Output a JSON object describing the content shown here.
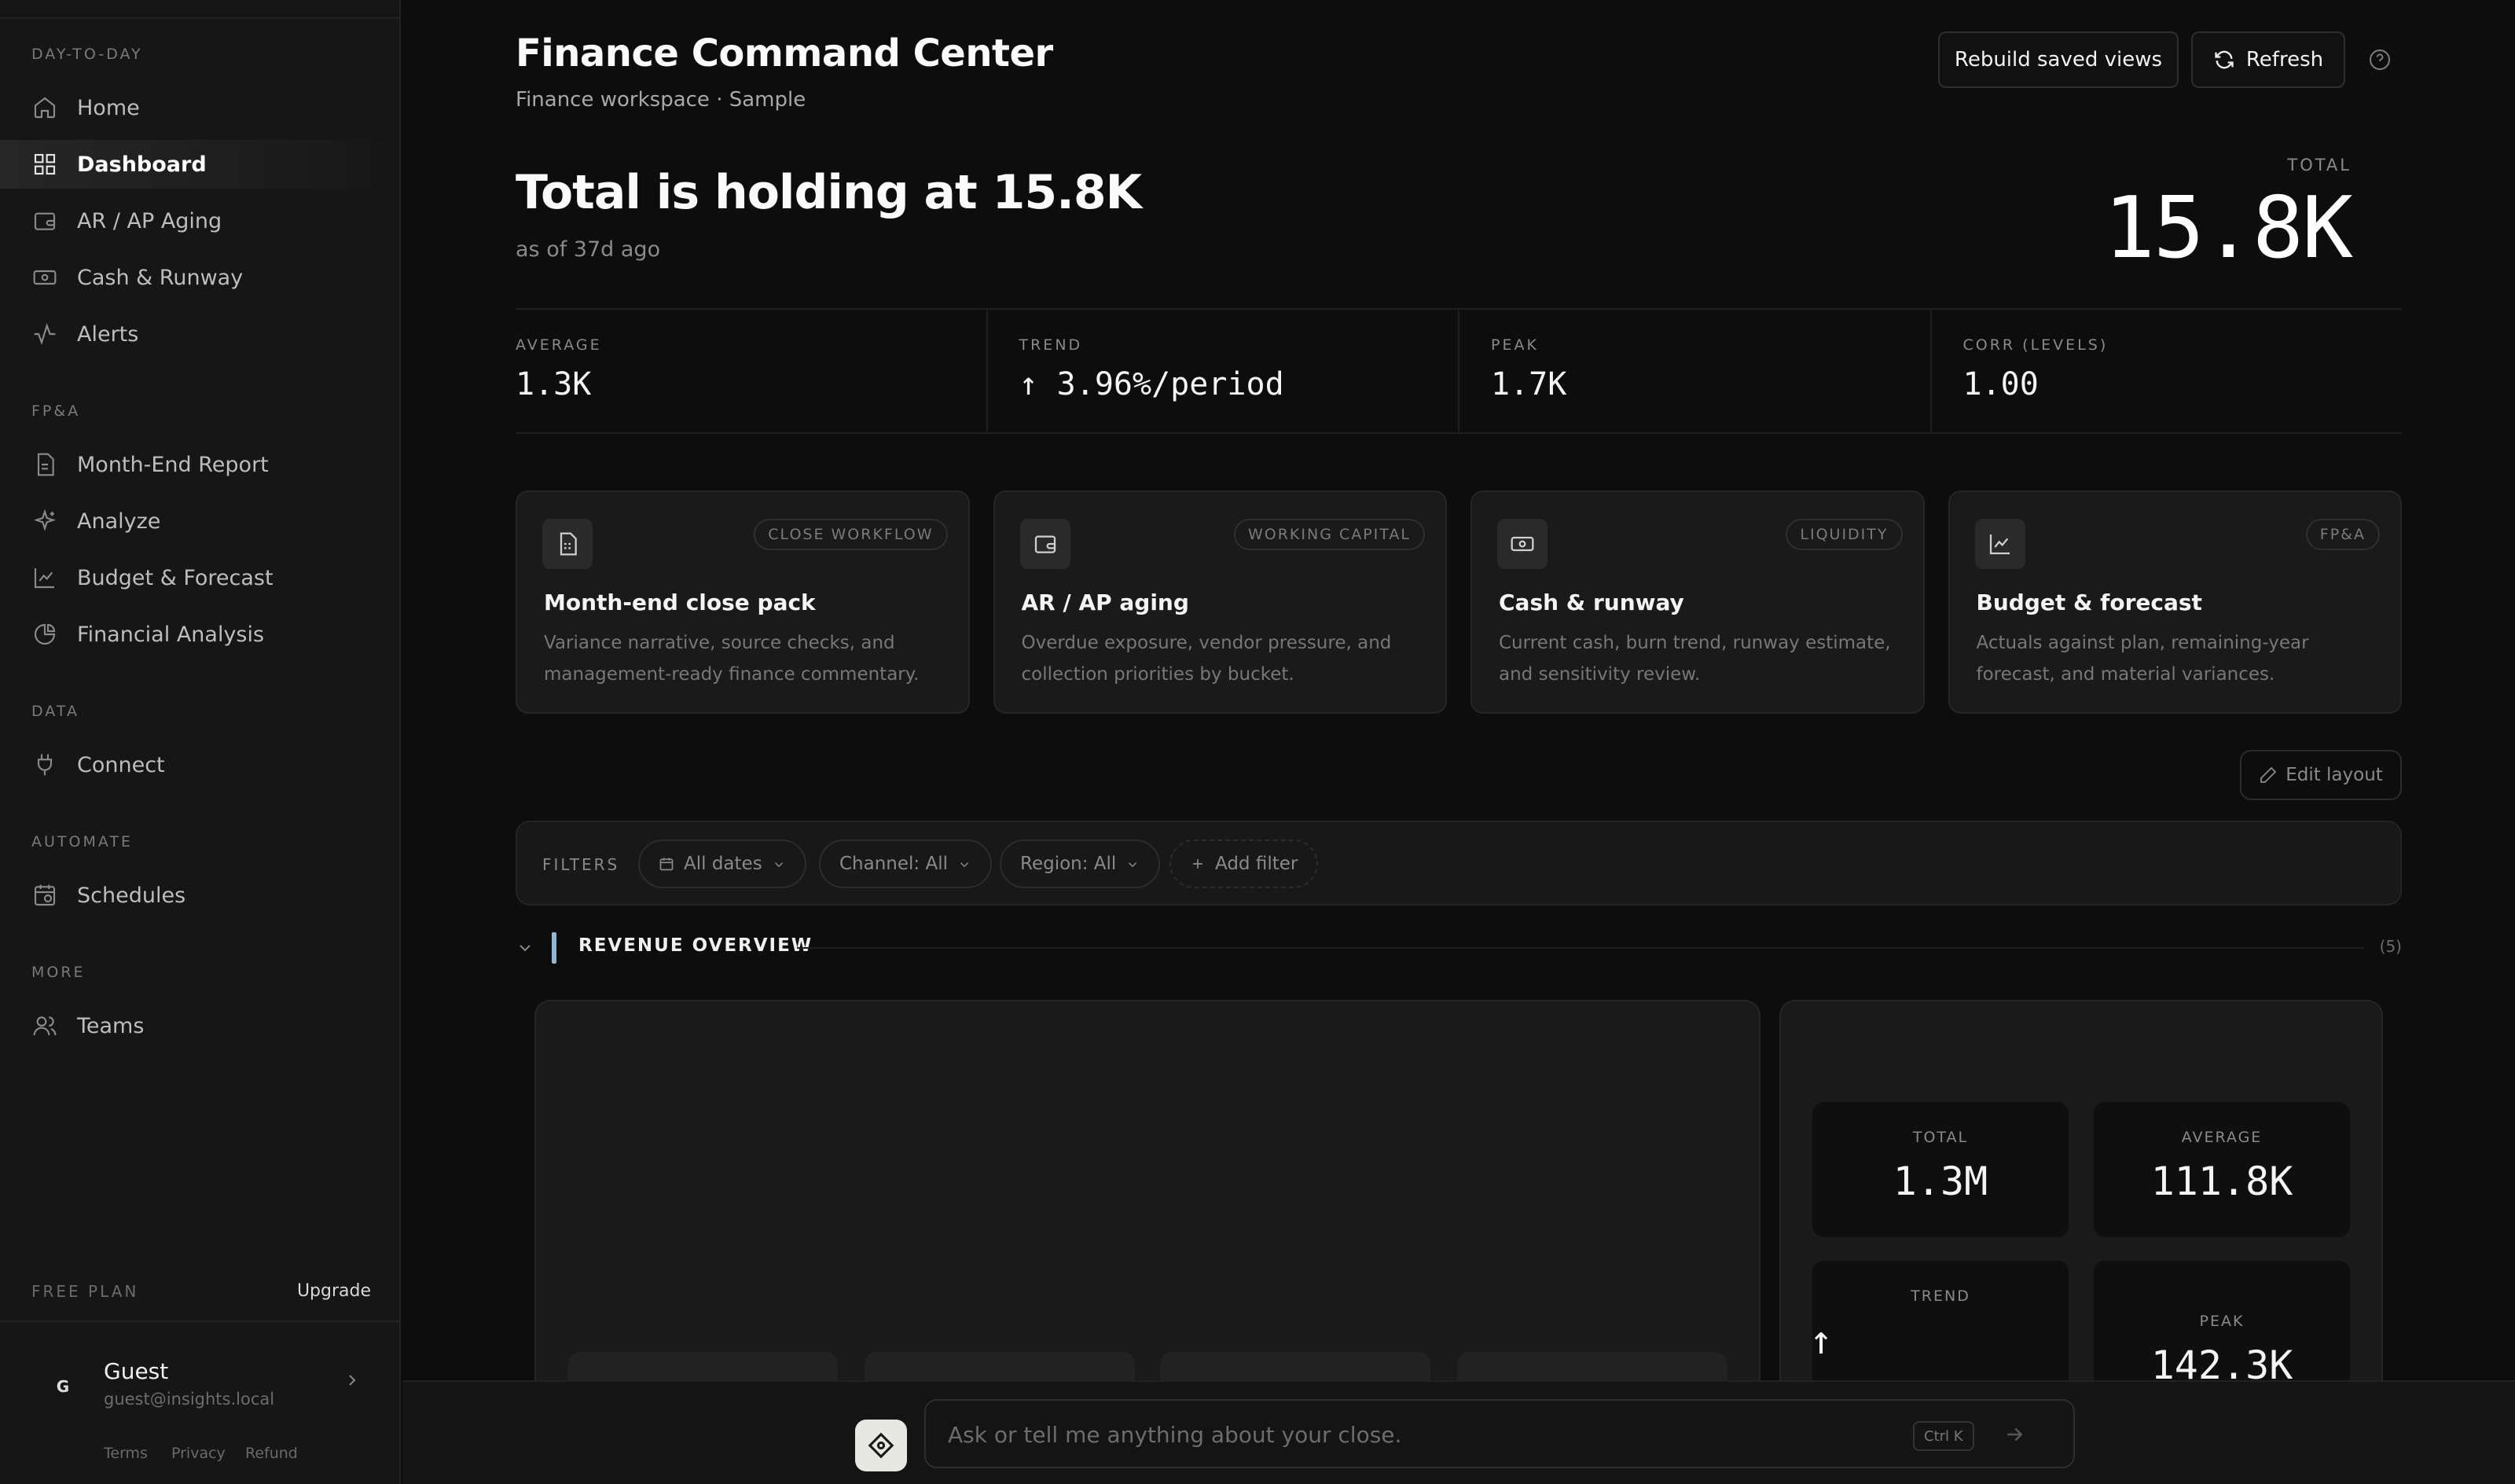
{
  "sidebar": {
    "sections": [
      {
        "label": "DAY-TO-DAY"
      },
      {
        "label": "FP&A"
      },
      {
        "label": "DATA"
      },
      {
        "label": "AUTOMATE"
      },
      {
        "label": "MORE"
      }
    ],
    "items": [
      {
        "label": "Home",
        "icon": "home-icon"
      },
      {
        "label": "Dashboard",
        "icon": "grid-icon",
        "active": true
      },
      {
        "label": "AR / AP Aging",
        "icon": "wallet-icon"
      },
      {
        "label": "Cash & Runway",
        "icon": "banknote-icon"
      },
      {
        "label": "Alerts",
        "icon": "activity-icon"
      },
      {
        "label": "Month-End Report",
        "icon": "file-text-icon"
      },
      {
        "label": "Analyze",
        "icon": "sparkles-icon"
      },
      {
        "label": "Budget & Forecast",
        "icon": "line-chart-icon"
      },
      {
        "label": "Financial Analysis",
        "icon": "pie-chart-icon"
      },
      {
        "label": "Connect",
        "icon": "plug-icon"
      },
      {
        "label": "Schedules",
        "icon": "calendar-clock-icon"
      },
      {
        "label": "Teams",
        "icon": "users-icon"
      }
    ],
    "plan": {
      "label": "FREE PLAN",
      "upgrade": "Upgrade"
    },
    "user": {
      "initial": "G",
      "name": "Guest",
      "email": "guest@insights.local"
    },
    "legal": {
      "terms": "Terms",
      "privacy": "Privacy",
      "refund": "Refund"
    }
  },
  "header": {
    "title": "Finance Command Center",
    "subtitle": "Finance workspace · Sample",
    "rebuild_label": "Rebuild saved views",
    "refresh_label": "Refresh"
  },
  "summary": {
    "headline": "Total is holding at 15.8K",
    "as_of": "as of 37d ago",
    "kpi_label": "TOTAL",
    "kpi_value": "15.8K"
  },
  "stats": [
    {
      "label": "AVERAGE",
      "value": "1.3K"
    },
    {
      "label": "TREND",
      "value": "↑ 3.96%/period"
    },
    {
      "label": "PEAK",
      "value": "1.7K"
    },
    {
      "label": "CORR (LEVELS)",
      "value": "1.00"
    }
  ],
  "cards": [
    {
      "tag": "CLOSE WORKFLOW",
      "title": "Month-end close pack",
      "desc": "Variance narrative, source checks, and management-ready finance commentary.",
      "icon": "file-text-icon"
    },
    {
      "tag": "WORKING CAPITAL",
      "title": "AR / AP aging",
      "desc": "Overdue exposure, vendor pressure, and collection priorities by bucket.",
      "icon": "wallet-icon"
    },
    {
      "tag": "LIQUIDITY",
      "title": "Cash & runway",
      "desc": "Current cash, burn trend, runway estimate, and sensitivity review.",
      "icon": "banknote-icon"
    },
    {
      "tag": "FP&A",
      "title": "Budget & forecast",
      "desc": "Actuals against plan, remaining-year forecast, and material variances.",
      "icon": "line-chart-icon"
    }
  ],
  "edit_layout": "Edit layout",
  "filters": {
    "label": "FILTERS",
    "chips": [
      "All dates",
      "Channel: All",
      "Region: All",
      "Add filter"
    ]
  },
  "section": {
    "title": "REVENUE OVERVIEW",
    "count": "(5)"
  },
  "metrics": [
    {
      "label": "TOTAL",
      "value": "1.3M"
    },
    {
      "label": "AVERAGE",
      "value": "111.8K"
    },
    {
      "label": "TREND",
      "value": "↑"
    },
    {
      "label": "PEAK",
      "value": "142.3K"
    }
  ],
  "ask": {
    "placeholder": "Ask or tell me anything about your close.",
    "shortcut": "Ctrl K"
  }
}
